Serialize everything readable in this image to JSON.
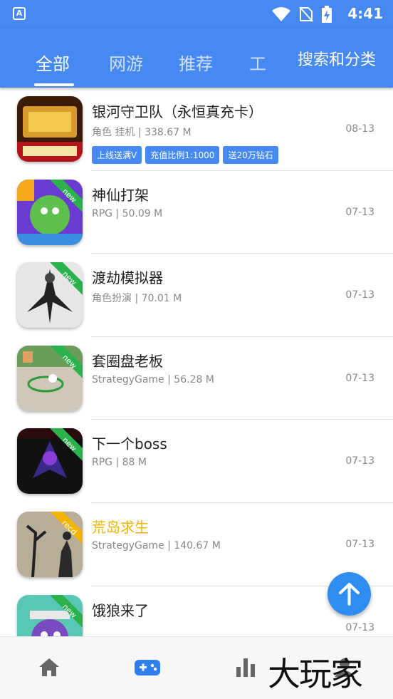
{
  "status_bar": {
    "time": "4:41",
    "app_icon_letter": "A"
  },
  "tabs": [
    {
      "label": "全部",
      "active": true
    },
    {
      "label": "网游",
      "active": false
    },
    {
      "label": "推荐",
      "active": false
    },
    {
      "label": "工",
      "active": false
    }
  ],
  "search_label": "搜索和分类",
  "games": [
    {
      "title": "银河守卫队（永恒真充卡）",
      "meta": "角色 挂机 | 338.67 M",
      "date": "08-13",
      "badge": "",
      "title_color": "#222222",
      "tags": [
        "上线送满V",
        "充值比例1:1000",
        "送20万钻石"
      ]
    },
    {
      "title": "神仙打架",
      "meta": "RPG | 50.09 M",
      "date": "07-13",
      "badge": "new",
      "title_color": "#222222"
    },
    {
      "title": "渡劫模拟器",
      "meta": "角色扮演 | 70.01 M",
      "date": "07-13",
      "badge": "new",
      "title_color": "#222222"
    },
    {
      "title": "套圈盘老板",
      "meta": "StrategyGame | 56.28 M",
      "date": "07-13",
      "badge": "new",
      "title_color": "#222222"
    },
    {
      "title": "下一个boss",
      "meta": "RPG | 88 M",
      "date": "07-13",
      "badge": "new",
      "title_color": "#222222"
    },
    {
      "title": "荒岛求生",
      "meta": "StrategyGame | 140.67 M",
      "date": "07-13",
      "badge": "recd",
      "title_color": "#f5b400"
    },
    {
      "title": "饿狼来了",
      "meta": "",
      "date": "07-13",
      "badge": "new",
      "title_color": "#222222"
    }
  ],
  "bottom_nav": [
    "home-icon",
    "gamepad-icon",
    "bar-chart-icon",
    "user-icon"
  ],
  "watermark": "大玩家",
  "colors": {
    "primary": "#4689f3",
    "tag": "#4689f3",
    "new_badge": "#2bb24c",
    "recd_badge": "#f5b400",
    "fab": "#2f8cf0"
  }
}
